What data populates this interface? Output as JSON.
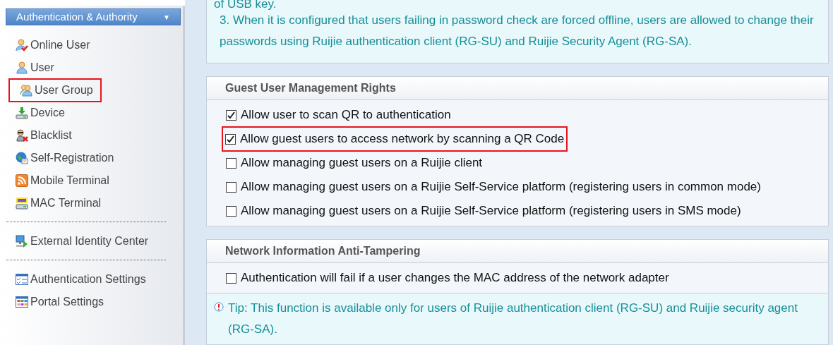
{
  "sidebar": {
    "header": {
      "label": "Authentication & Authority",
      "caret": "▼"
    },
    "groups": [
      {
        "items": [
          {
            "label": "Online User",
            "kind": "user-check",
            "highlighted": false
          },
          {
            "label": "User",
            "kind": "user",
            "highlighted": false
          },
          {
            "label": "User Group",
            "kind": "users",
            "highlighted": true
          },
          {
            "label": "Device",
            "kind": "device",
            "highlighted": false
          },
          {
            "label": "Blacklist",
            "kind": "blacklist",
            "highlighted": false
          },
          {
            "label": "Self-Registration",
            "kind": "globe",
            "highlighted": false
          },
          {
            "label": "Mobile Terminal",
            "kind": "rss",
            "highlighted": false
          },
          {
            "label": "MAC Terminal",
            "kind": "mac",
            "highlighted": false
          }
        ]
      },
      {
        "items": [
          {
            "label": "External Identity Center",
            "kind": "monitor",
            "highlighted": false
          }
        ]
      },
      {
        "items": [
          {
            "label": "Authentication Settings",
            "kind": "list",
            "highlighted": false
          },
          {
            "label": "Portal Settings",
            "kind": "grid",
            "highlighted": false
          }
        ]
      }
    ]
  },
  "notes": {
    "lines": [
      "of USB key.",
      "3. When it is configured that users failing in password check are forced offline, users are allowed to change their passwords using Ruijie authentication client (RG-SU) and Ruijie Security Agent (RG-SA)."
    ]
  },
  "sections": [
    {
      "title": "Guest User Management Rights",
      "options": [
        {
          "label": "Allow user to scan QR to authentication",
          "checked": true,
          "highlighted": false
        },
        {
          "label": "Allow guest users to access network by scanning a QR Code",
          "checked": true,
          "highlighted": true
        },
        {
          "label": "Allow managing guest users on a Ruijie client",
          "checked": false,
          "highlighted": false
        },
        {
          "label": "Allow managing guest users on a Ruijie Self-Service platform (registering users in common mode)",
          "checked": false,
          "highlighted": false
        },
        {
          "label": "Allow managing guest users on a Ruijie Self-Service platform (registering users in SMS mode)",
          "checked": false,
          "highlighted": false
        }
      ]
    },
    {
      "title": "Network Information Anti-Tampering",
      "options": [
        {
          "label": "Authentication will fail if a user changes the MAC address of the network adapter",
          "checked": false,
          "highlighted": false
        }
      ],
      "tip": "Tip: This function is available only for users of Ruijie authentication client (RG-SU) and Ruijie security agent (RG-SA)."
    }
  ]
}
